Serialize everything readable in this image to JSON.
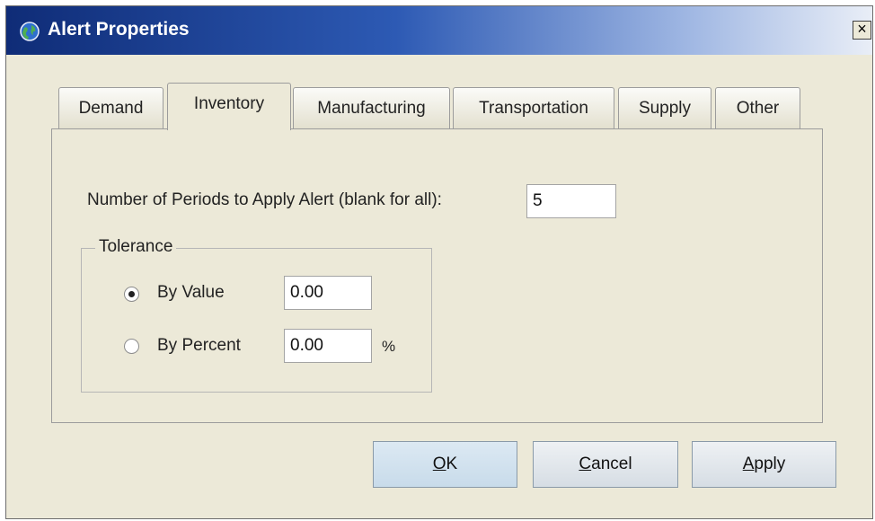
{
  "window": {
    "title": "Alert Properties",
    "close_label": "×",
    "colors": {
      "titlebar_start": "#0f2c77",
      "titlebar_end": "#e9eef7",
      "dialog_bg": "#ece9d8"
    }
  },
  "tabs": [
    {
      "label": "Demand",
      "selected": false
    },
    {
      "label": "Inventory",
      "selected": true
    },
    {
      "label": "Manufacturing",
      "selected": false
    },
    {
      "label": "Transportation",
      "selected": false
    },
    {
      "label": "Supply",
      "selected": false
    },
    {
      "label": "Other",
      "selected": false
    }
  ],
  "periods": {
    "label": "Number of Periods to Apply Alert (blank for all):",
    "value": "5"
  },
  "tolerance": {
    "title": "Tolerance",
    "by_value": {
      "label": "By Value",
      "selected": true,
      "value": "0.00"
    },
    "by_percent": {
      "label": "By Percent",
      "selected": false,
      "value": "0.00",
      "unit": "%"
    }
  },
  "buttons": {
    "ok": {
      "mnemonic": "O",
      "rest": "K"
    },
    "cancel": {
      "mnemonic": "C",
      "rest": "ancel"
    },
    "apply": {
      "mnemonic": "A",
      "rest": "pply"
    }
  },
  "icons": {
    "title": "globe-icon",
    "close": "close-icon"
  }
}
